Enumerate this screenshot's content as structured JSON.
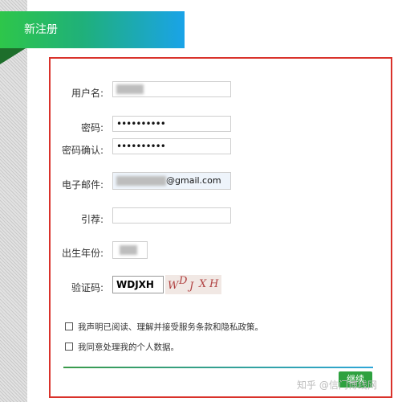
{
  "header": {
    "title": "新注册"
  },
  "form": {
    "username_label": "用户名:",
    "password_label": "密码:",
    "password_value": "••••••••••",
    "confirm_label": "密码确认:",
    "confirm_value": "••••••••••",
    "email_label": "电子邮件:",
    "email_suffix": "@gmail.com",
    "referral_label": "引荐:",
    "referral_value": "",
    "birth_year_label": "出生年份:",
    "captcha_label": "验证码:",
    "captcha_value": "WDJXH",
    "captcha_chars": [
      "W",
      "D",
      "J",
      "X",
      "H"
    ],
    "terms_label": "我声明已阅读、理解并接受服务条款和隐私政策。",
    "consent_label": "我同意处理我的个人数据。",
    "submit_label": "继续"
  },
  "watermark": "知乎 @信门博线网",
  "colors": {
    "accent_green": "#2ea13f",
    "border_red": "#d9322b",
    "header_blue": "#1aa3e8"
  }
}
